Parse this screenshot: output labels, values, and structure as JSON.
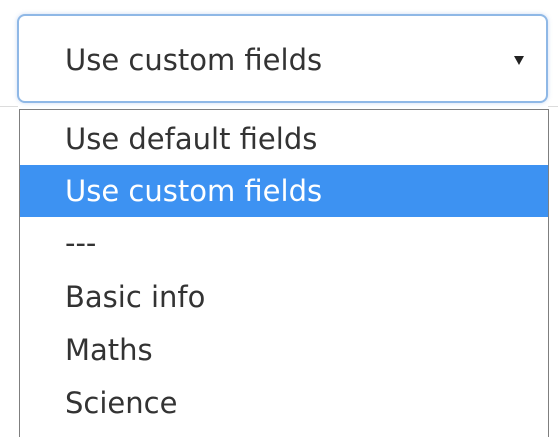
{
  "select": {
    "current_value": "Use custom fields",
    "caret_icon": "caret-down-icon"
  },
  "options": [
    {
      "label": "Use default fields",
      "selected": false
    },
    {
      "label": "Use custom fields",
      "selected": true
    },
    {
      "label": "---",
      "selected": false
    },
    {
      "label": "Basic info",
      "selected": false
    },
    {
      "label": "Maths",
      "selected": false
    },
    {
      "label": "Science",
      "selected": false
    }
  ],
  "colors": {
    "highlight": "#3d92f2",
    "focus_border": "#8fb8e6",
    "text": "#333333"
  }
}
